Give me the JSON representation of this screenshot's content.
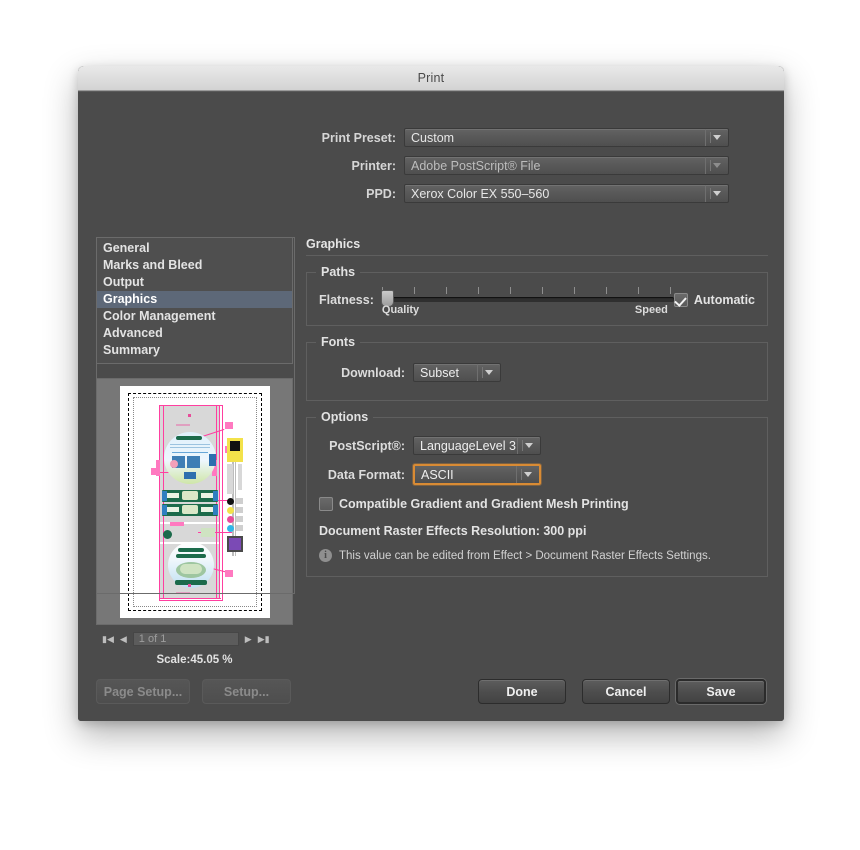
{
  "window": {
    "title": "Print"
  },
  "top_fields": [
    {
      "label": "Print Preset:",
      "value": "Custom",
      "dim": false
    },
    {
      "label": "Printer:",
      "value": "Adobe PostScript® File",
      "dim": true
    },
    {
      "label": "PPD:",
      "value": "Xerox Color EX 550–560",
      "dim": false
    }
  ],
  "preset_save_icon": "save-preset-icon",
  "sidebar": {
    "items": [
      {
        "label": "General",
        "selected": false
      },
      {
        "label": "Marks and Bleed",
        "selected": false
      },
      {
        "label": "Output",
        "selected": false
      },
      {
        "label": "Graphics",
        "selected": true
      },
      {
        "label": "Color Management",
        "selected": false
      },
      {
        "label": "Advanced",
        "selected": false
      },
      {
        "label": "Summary",
        "selected": false
      }
    ]
  },
  "preview": {
    "first_page_icon": "first-page-icon",
    "prev_page_icon": "previous-page-icon",
    "page_value": "1 of 1",
    "next_page_icon": "next-page-icon",
    "last_page_icon": "last-page-icon",
    "scale_label": "Scale:45.05 %"
  },
  "panel": {
    "title": "Graphics",
    "paths": {
      "title": "Paths",
      "flatness_label": "Flatness:",
      "quality_label": "Quality",
      "speed_label": "Speed",
      "slider_value": 0,
      "tick_count": 10,
      "automatic_label": "Automatic",
      "automatic_checked": true
    },
    "fonts": {
      "title": "Fonts",
      "download_label": "Download:",
      "download_value": "Subset"
    },
    "options": {
      "title": "Options",
      "postscript_label": "PostScript®:",
      "postscript_value": "LanguageLevel 3",
      "data_format_label": "Data Format:",
      "data_format_value": "ASCII",
      "data_format_focused": true,
      "gradient_label": "Compatible Gradient and Gradient Mesh Printing",
      "gradient_checked": false,
      "raster_label": "Document Raster Effects Resolution: 300 ppi",
      "info_icon": "info-icon",
      "info_note": "This value can be edited from Effect > Document Raster Effects Settings."
    }
  },
  "footer": {
    "page_setup": "Page Setup...",
    "setup": "Setup...",
    "done": "Done",
    "cancel": "Cancel",
    "save": "Save"
  },
  "colors": {
    "dialog_bg": "#4b4b4b",
    "selection": "#5d6878",
    "focus_ring": "#d98b34",
    "titlebar": "#dfdfdf"
  }
}
